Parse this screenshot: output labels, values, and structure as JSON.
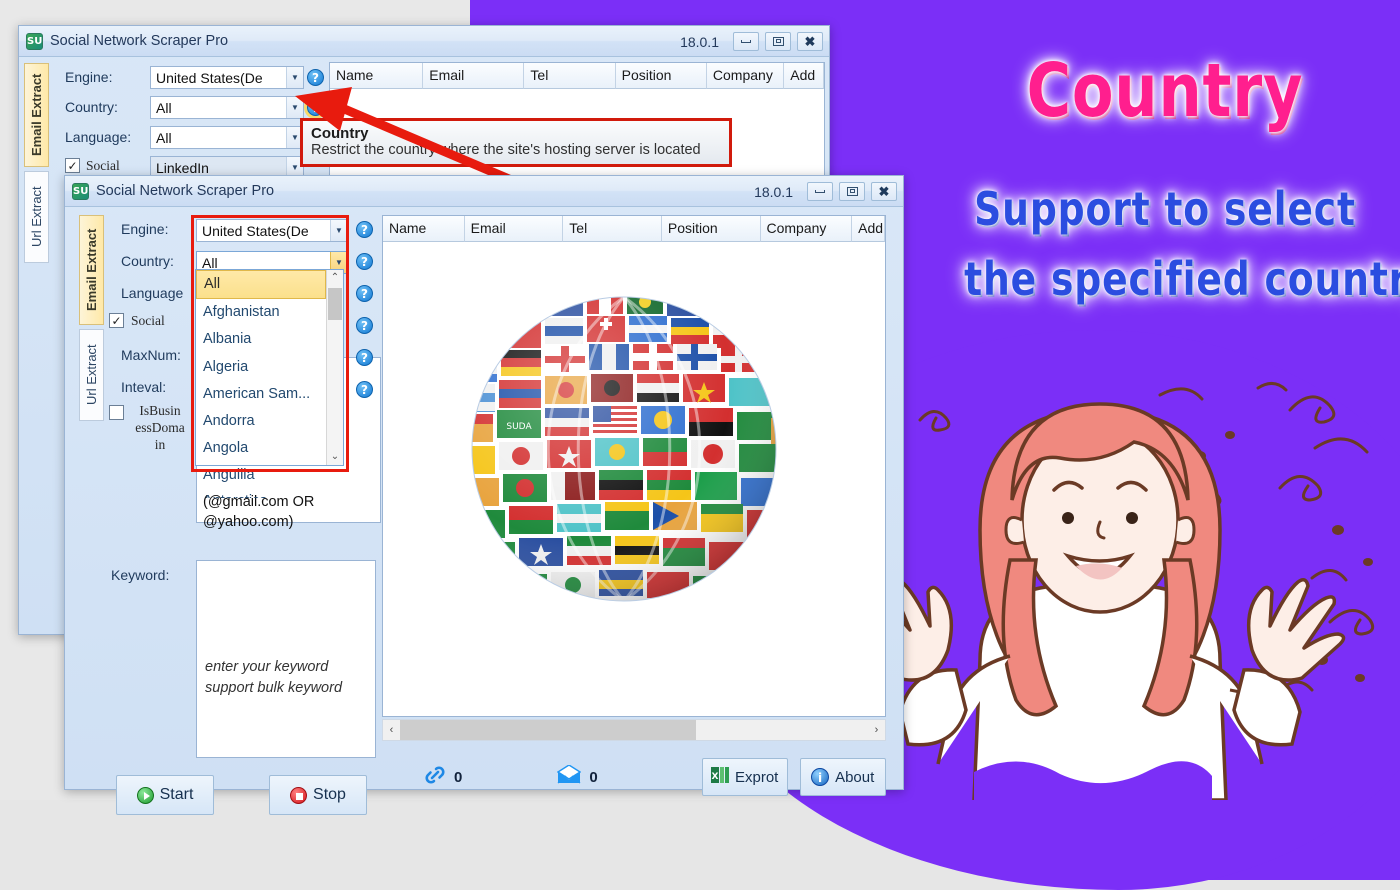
{
  "promo": {
    "title": "Country",
    "line1": "Support to select",
    "line2": "the specified country",
    "bg_color": "#7b2ff7",
    "title_color": "#ff1f8e",
    "line_color": "#2b4de0"
  },
  "window_back": {
    "title": "Social Network Scraper Pro",
    "version": "18.0.1",
    "icon": "app-icon",
    "buttons": {
      "minimize": "minimize-button",
      "maximize": "maximize-button",
      "close": "close-button"
    },
    "tabs": [
      {
        "label": "Email Extract",
        "active": true
      },
      {
        "label": "Url Extract",
        "active": false
      }
    ],
    "fields": [
      {
        "label": "Engine:",
        "value": "United States(De"
      },
      {
        "label": "Country:",
        "value": "All"
      },
      {
        "label": "Language:",
        "value": "All"
      }
    ],
    "social": {
      "label": "Social",
      "checked": "✓",
      "value": "LinkedIn"
    },
    "table_headers": [
      "Name",
      "Email",
      "Tel",
      "Position",
      "Company",
      "Add"
    ]
  },
  "window_front": {
    "title": "Social Network Scraper Pro",
    "version": "18.0.1",
    "icon": "app-icon",
    "buttons": {
      "minimize": "minimize-button",
      "maximize": "maximize-button",
      "close": "close-button"
    },
    "tabs": [
      {
        "label": "Email Extract",
        "active": true
      },
      {
        "label": "Url Extract",
        "active": false
      }
    ],
    "fields": [
      {
        "label": "Engine:",
        "value": "United States(De"
      },
      {
        "label": "Country:",
        "value": "All"
      },
      {
        "label": "Language:",
        "value": ""
      }
    ],
    "social": {
      "label": "Social",
      "checked": "✓"
    },
    "maxnum_label": "MaxNum:",
    "inteval_label": "Inteval:",
    "isbusiness_label": "IsBusin essDoma in",
    "email_filter_value": "(@gmail.com OR @yahoo.com)",
    "keyword_label": "Keyword:",
    "keyword_placeholder_line1": "enter your keyword",
    "keyword_placeholder_line2": "support bulk keyword",
    "start_button": "Start",
    "stop_button": "Stop",
    "table_headers": [
      "Name",
      "Email",
      "Tel",
      "Position",
      "Company",
      "Add"
    ],
    "status": {
      "link_count": "0",
      "mail_count": "0",
      "export_button": "Exprot",
      "about_button": "About"
    },
    "help_icons_count": 6,
    "help_glyph": "?"
  },
  "country_dropdown": {
    "selected": "All",
    "options": [
      "All",
      "Afghanistan",
      "Albania",
      "Algeria",
      "American Sam...",
      "Andorra",
      "Angola",
      "Anguilla",
      "Antarctica"
    ],
    "scroll_up": "⌃",
    "scroll_down": "⌄"
  },
  "tooltip": {
    "title": "Country",
    "body": "Restrict the country where the site's hosting server is located"
  },
  "scrollbar": {
    "left_arrow": "‹",
    "right_arrow": "›"
  },
  "icons": {
    "link": "link-icon",
    "mail": "mail-icon",
    "excel": "excel-icon",
    "info": "info-icon",
    "play": "play-icon",
    "stop": "stop-icon",
    "globe": "globe-flags-icon"
  }
}
